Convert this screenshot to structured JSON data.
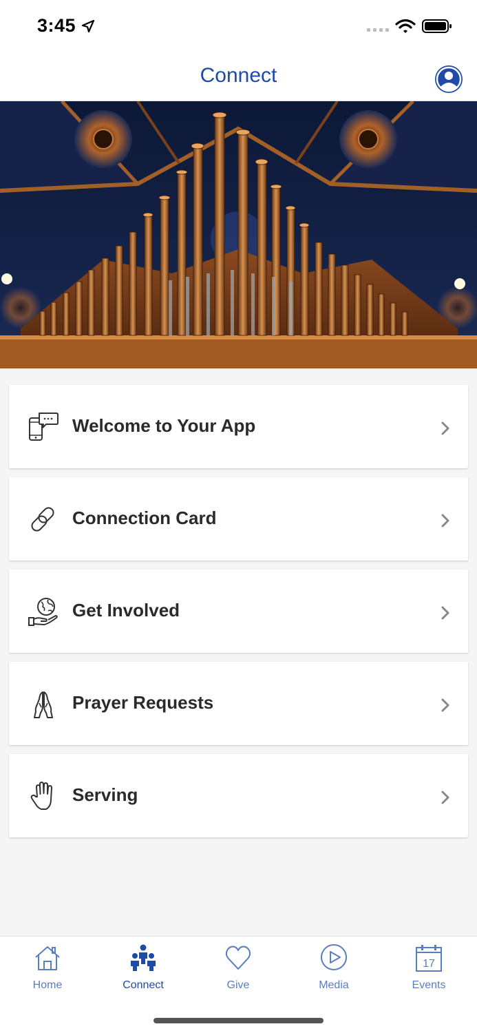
{
  "status_bar": {
    "time": "3:45"
  },
  "header": {
    "title": "Connect"
  },
  "menu": {
    "items": [
      {
        "label": "Welcome to Your App",
        "icon": "chat-phone-icon"
      },
      {
        "label": "Connection Card",
        "icon": "link-icon"
      },
      {
        "label": "Get Involved",
        "icon": "globe-hand-icon"
      },
      {
        "label": "Prayer Requests",
        "icon": "praying-hands-icon"
      },
      {
        "label": "Serving",
        "icon": "raised-hand-icon"
      }
    ]
  },
  "tabs": [
    {
      "label": "Home",
      "icon": "home-icon"
    },
    {
      "label": "Connect",
      "icon": "people-icon",
      "active": true
    },
    {
      "label": "Give",
      "icon": "heart-icon"
    },
    {
      "label": "Media",
      "icon": "play-icon"
    },
    {
      "label": "Events",
      "icon": "calendar-icon",
      "day": "17"
    }
  ],
  "colors": {
    "accent": "#1f4aa8",
    "tab_inactive": "#5a7cc2",
    "background": "#f5f5f5"
  }
}
